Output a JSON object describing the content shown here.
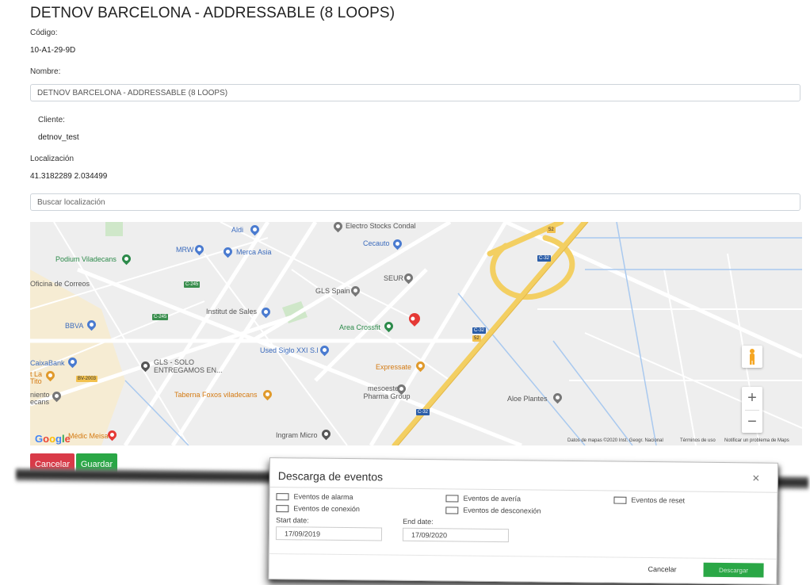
{
  "page": {
    "title": "DETNOV BARCELONA - ADDRESSABLE (8 LOOPS)",
    "codigo_label": "Código:",
    "codigo_value": "10-A1-29-9D",
    "nombre_label": "Nombre:",
    "nombre_value": "DETNOV BARCELONA - ADDRESSABLE (8 LOOPS)",
    "cliente_label": "Cliente:",
    "cliente_value": "detnov_test",
    "localizacion_label": "Localización",
    "localizacion_value": "41.3182289 2.034499",
    "search_placeholder": "Buscar localización",
    "cancel_label": "Cancelar",
    "save_label": "Guardar"
  },
  "map": {
    "labels": {
      "aldi": "Aldi",
      "electro": "Electro Stocks Condal",
      "cecauto": "Cecauto",
      "podium": "Podium Viladecans",
      "mrw": "MRW",
      "merca": "Merca Asia",
      "correos": "Oficina de Correos",
      "seur": "SEUR",
      "gls_spain": "GLS Spain",
      "institut": "Institut de Sales",
      "bbva": "BBVA",
      "area": "Area Crossfit",
      "used": "Used Siglo XXI S.l",
      "caixa": "CaixaBank",
      "gls_solo": "GLS - SOLO ENTREGAMOS EN...",
      "itla": "t La Tito",
      "expressate": "Expressate",
      "mesoestetic": "mesoestetic Pharma Group",
      "aloe": "Aloe Plantes",
      "taberna": "Taberna Foxos viladecans",
      "miento": "niento ecans",
      "medic": "Médic Meisa",
      "ingram": "Ingram Micro",
      "c245a": "C-245",
      "c245b": "C-245",
      "c32a": "C-32",
      "c32b": "C-32",
      "c32c": "C-32",
      "bv2003": "BV-2003",
      "s52": "52",
      "s52b": "52"
    },
    "google": "Google",
    "attrib_data": "Datos de mapas ©2020 Inst. Geogr. Nacional",
    "attrib_terms": "Términos de uso",
    "attrib_report": "Notificar un problema de Maps",
    "zoom_in": "+",
    "zoom_out": "−"
  },
  "modal": {
    "title": "Descarga de eventos",
    "close": "✕",
    "checkboxes": [
      "Eventos de alarma",
      "Eventos de avería",
      "Eventos de reset",
      "Eventos de conexión",
      "Eventos de desconexión"
    ],
    "start_label": "Start date:",
    "start_value": "17/09/2019",
    "end_label": "End date:",
    "end_value": "17/09/2020",
    "cancel_label": "Cancelar",
    "download_label": "Descargar"
  },
  "colors": {
    "danger": "#d93a48",
    "success": "#2aa746",
    "pin_red": "#e53935"
  }
}
